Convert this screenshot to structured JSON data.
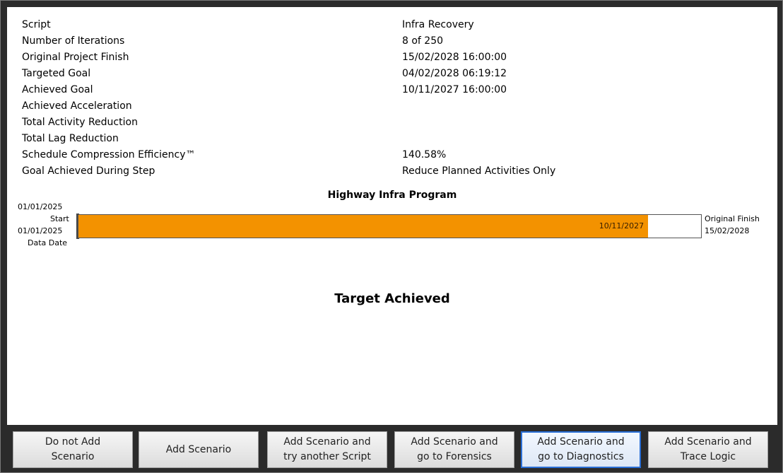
{
  "info": {
    "rows": [
      {
        "label": "Script",
        "value": "Infra Recovery"
      },
      {
        "label": "Number of Iterations",
        "value": "8 of 250"
      },
      {
        "label": "Original Project Finish",
        "value": "15/02/2028 16:00:00"
      },
      {
        "label": "Targeted Goal",
        "value": "04/02/2028 06:19:12"
      },
      {
        "label": "Achieved Goal",
        "value": "10/11/2027 16:00:00"
      },
      {
        "label": "Achieved Acceleration",
        "value": ""
      },
      {
        "label": "Total Activity Reduction",
        "value": ""
      },
      {
        "label": "Total Lag Reduction",
        "value": ""
      },
      {
        "label": "Schedule Compression Efficiency™",
        "value": "140.58%"
      },
      {
        "label": "Goal Achieved During Step",
        "value": "Reduce Planned Activities Only"
      }
    ]
  },
  "chart": {
    "title": "Highway Infra Program",
    "start_date": "01/01/2025",
    "start_label": "Start",
    "data_date": "01/01/2025",
    "data_date_label": "Data Date",
    "achieved_label": "10/11/2027",
    "original_finish_label": "Original Finish",
    "original_finish_date": "15/02/2028",
    "fill_color": "#f39200"
  },
  "chart_data": {
    "type": "bar",
    "title": "Highway Infra Program",
    "categories": [
      "Highway Infra Program"
    ],
    "start": "01/01/2025",
    "achieved_finish": "10/11/2027",
    "original_finish": "15/02/2028",
    "progress_fraction": 0.915
  },
  "status": {
    "text": "Target Achieved"
  },
  "buttons": [
    {
      "label": "Do not Add\nScenario"
    },
    {
      "label": "Add Scenario"
    },
    {
      "label": "Add Scenario and\ntry another Script"
    },
    {
      "label": "Add Scenario and\ngo to Forensics"
    },
    {
      "label": "Add Scenario and\ngo to Diagnostics"
    },
    {
      "label": "Add Scenario and\nTrace Logic"
    }
  ]
}
